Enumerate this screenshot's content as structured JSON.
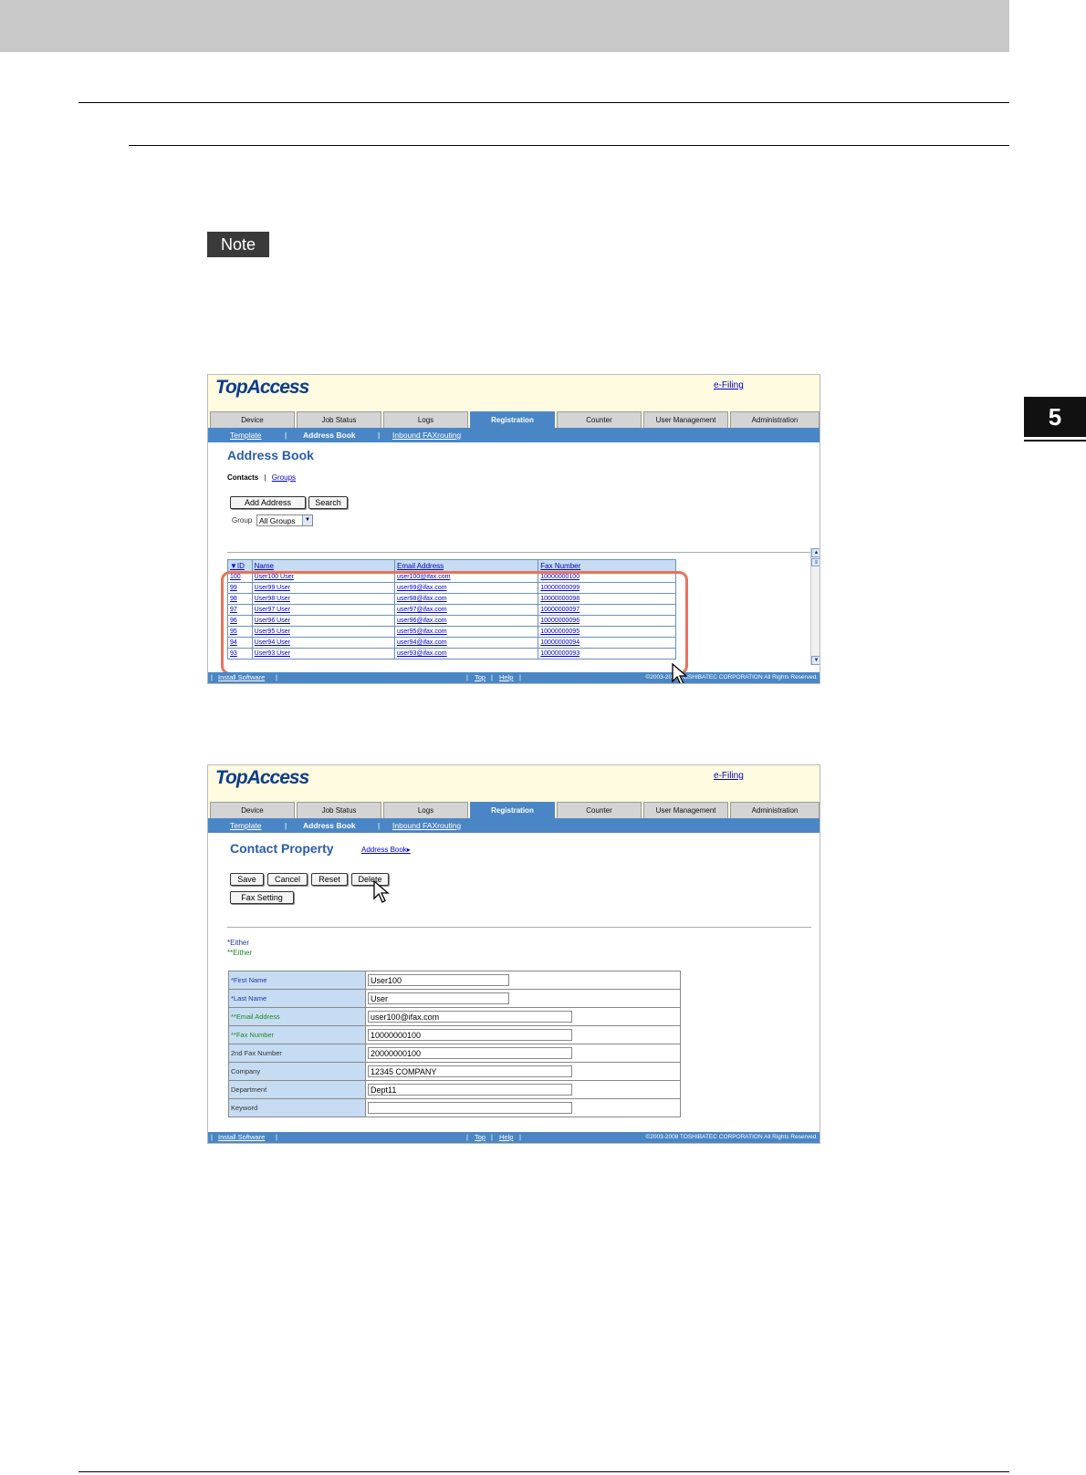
{
  "page": {
    "note_label": "Note",
    "chapter_number": "5"
  },
  "app": {
    "logo": "TopAccess",
    "efiling_link": "e-Filing",
    "tabs": [
      {
        "label": "Device"
      },
      {
        "label": "Job Status"
      },
      {
        "label": "Logs"
      },
      {
        "label": "Registration",
        "active": true
      },
      {
        "label": "Counter"
      },
      {
        "label": "User Management"
      },
      {
        "label": "Administration"
      }
    ],
    "subnav": {
      "template": "Template",
      "address_book": "Address Book",
      "inbound": "Inbound FAXrouting",
      "sep": "|"
    },
    "footer": {
      "install": "Install Software",
      "top": "Top",
      "help": "Help",
      "copyright": "©2003-2008 TOSHIBATEC CORPORATION All Rights Reserved.",
      "sep": "|"
    }
  },
  "shot1": {
    "heading": "Address Book",
    "contacts_label": "Contacts",
    "groups_link": "Groups",
    "sep": "|",
    "add_button": "Add Address",
    "search_button": "Search",
    "group_label": "Group",
    "group_select": "All Groups",
    "columns": [
      "▼ID",
      "Name",
      "Email Address",
      "Fax Number"
    ],
    "rows": [
      [
        "100",
        "User100 User",
        "user100@ifax.com",
        "10000000100"
      ],
      [
        "99",
        "User99 User",
        "user99@ifax.com",
        "10000000099"
      ],
      [
        "98",
        "User98 User",
        "user98@ifax.com",
        "10000000098"
      ],
      [
        "97",
        "User97 User",
        "user97@ifax.com",
        "10000000097"
      ],
      [
        "96",
        "User96 User",
        "user96@ifax.com",
        "10000000096"
      ],
      [
        "95",
        "User95 User",
        "user95@ifax.com",
        "10000000095"
      ],
      [
        "94",
        "User94 User",
        "user94@ifax.com",
        "10000000094"
      ],
      [
        "93",
        "User93 User",
        "user93@ifax.com",
        "10000000093"
      ]
    ]
  },
  "shot2": {
    "heading": "Contact Property",
    "back_link": "Address Book▸",
    "buttons": {
      "save": "Save",
      "cancel": "Cancel",
      "reset": "Reset",
      "delete": "Delete",
      "fax_setting": "Fax Setting"
    },
    "legend_either": "*Either",
    "legend_either2": "**Either",
    "fields": [
      {
        "label": "*First Name",
        "value": "User100",
        "color": "blue"
      },
      {
        "label": "*Last Name",
        "value": "User",
        "color": "blue"
      },
      {
        "label": "**Email Address",
        "value": "user100@ifax.com",
        "color": "green"
      },
      {
        "label": "**Fax Number",
        "value": "10000000100",
        "color": "green"
      },
      {
        "label": "2nd Fax Number",
        "value": "20000000100",
        "color": "plain"
      },
      {
        "label": "Company",
        "value": "12345 COMPANY",
        "color": "plain"
      },
      {
        "label": "Department",
        "value": "Dept11",
        "color": "plain"
      },
      {
        "label": "Keyword",
        "value": "",
        "color": "plain"
      }
    ]
  }
}
